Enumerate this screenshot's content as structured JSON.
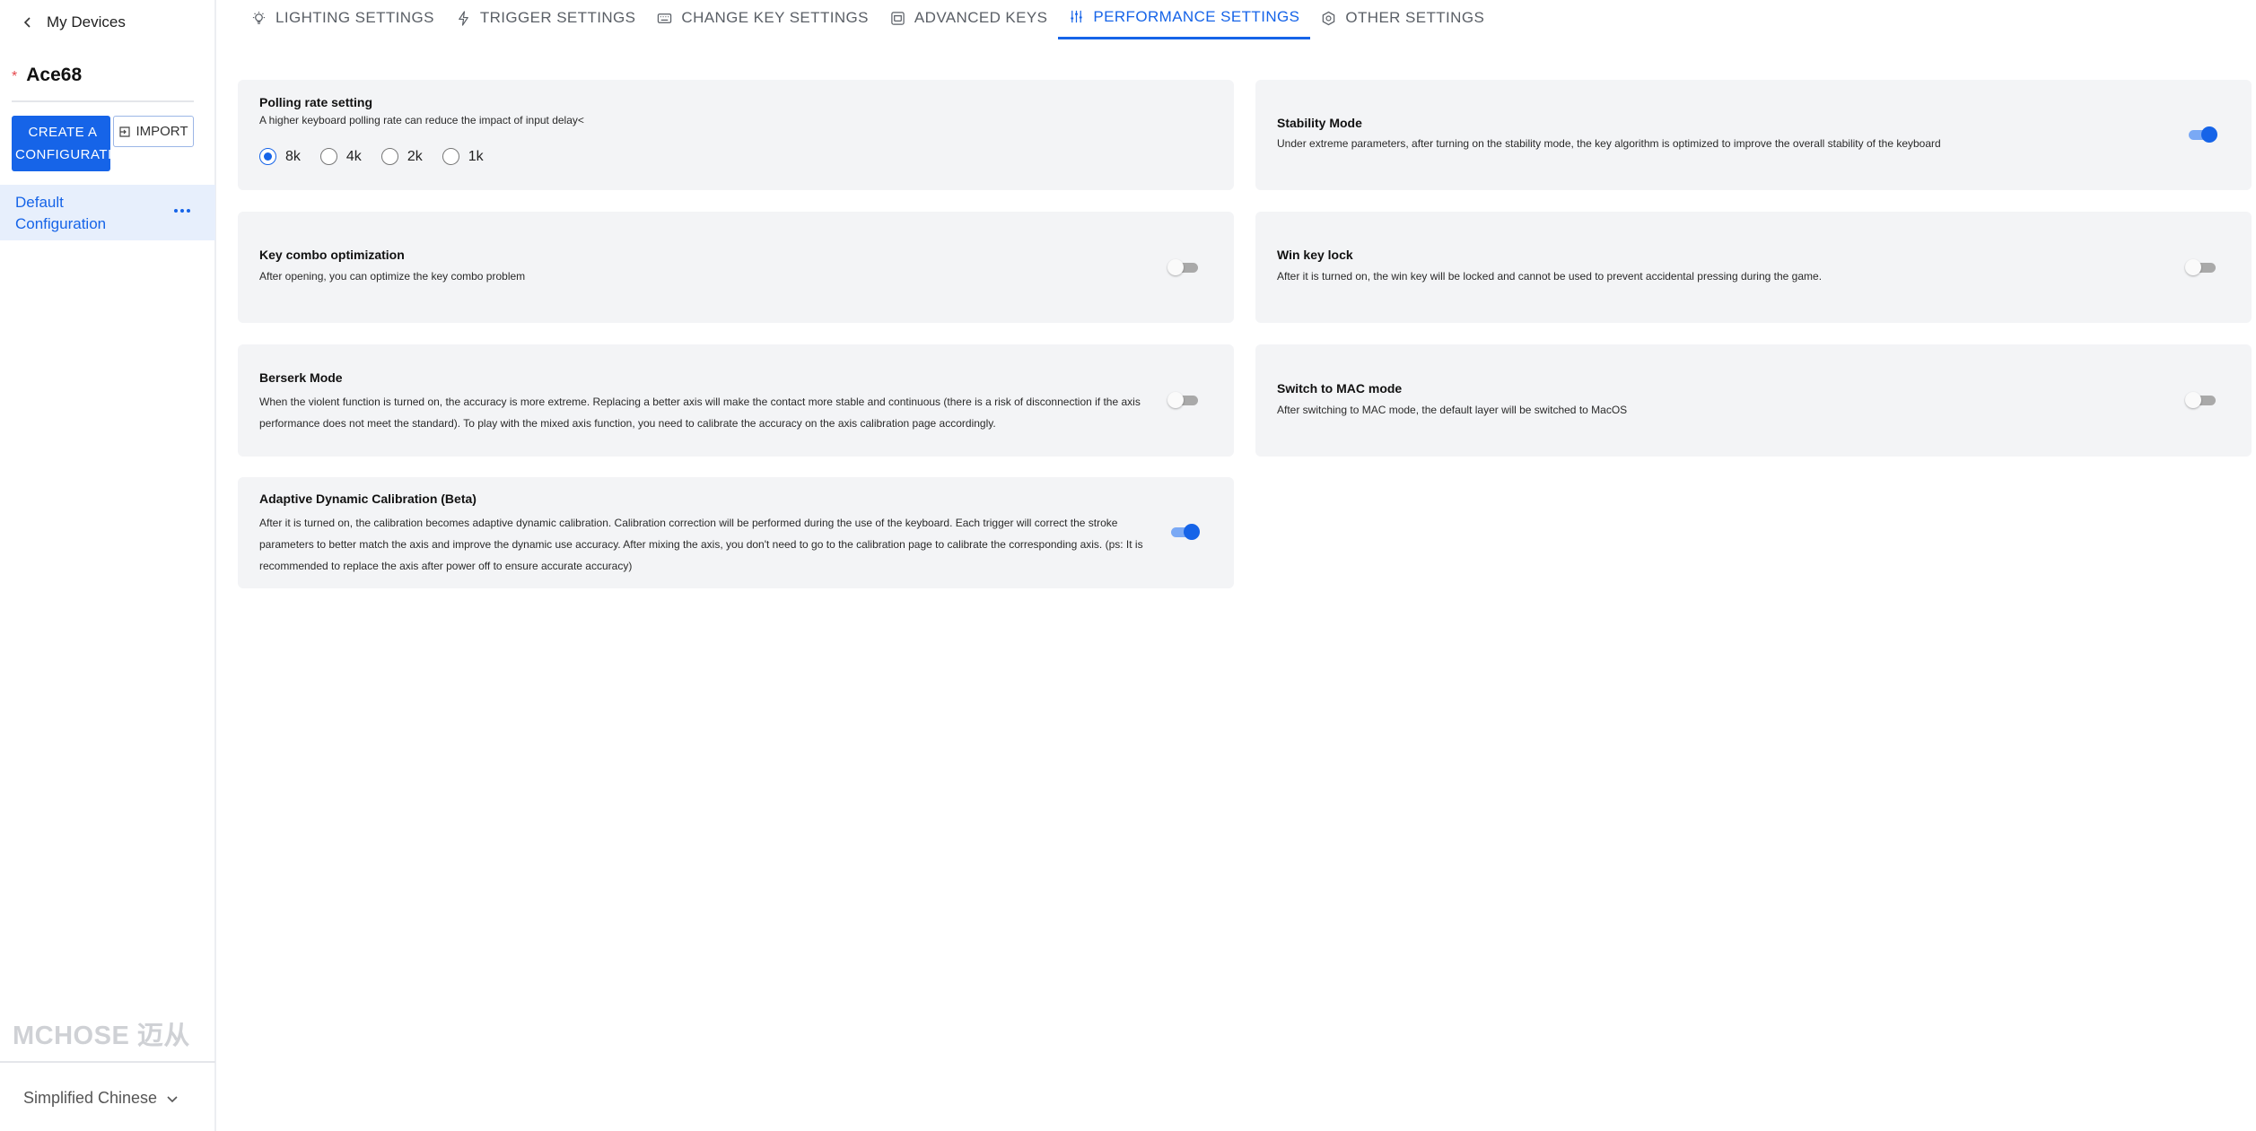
{
  "sidebar": {
    "back_label": "My Devices",
    "device_name": "Ace68",
    "create_label": "CREATE A CONFIGURATION",
    "import_label": "IMPORT",
    "configs": [
      {
        "label": "Default Configuration"
      }
    ],
    "brand": "MCHOSE 迈从",
    "language": "Simplified Chinese"
  },
  "tabs": [
    {
      "label": "LIGHTING SETTINGS",
      "icon": "bulb-icon",
      "active": false
    },
    {
      "label": "TRIGGER SETTINGS",
      "icon": "lightning-icon",
      "active": false
    },
    {
      "label": "CHANGE KEY SETTINGS",
      "icon": "keyboard-icon",
      "active": false
    },
    {
      "label": "ADVANCED KEYS",
      "icon": "advanced-key-icon",
      "active": false
    },
    {
      "label": "PERFORMANCE SETTINGS",
      "icon": "sliders-icon",
      "active": true
    },
    {
      "label": "OTHER SETTINGS",
      "icon": "hexagon-gear-icon",
      "active": false
    }
  ],
  "polling": {
    "title": "Polling rate setting",
    "desc": "A higher keyboard polling rate can reduce the impact of input delay<",
    "options": [
      "8k",
      "4k",
      "2k",
      "1k"
    ],
    "selected": "8k"
  },
  "settings": {
    "stability": {
      "title": "Stability Mode",
      "desc": "Under extreme parameters, after turning on the stability mode, the key algorithm is optimized to improve the overall stability of the keyboard",
      "on": true
    },
    "combo": {
      "title": "Key combo optimization",
      "desc": "After opening, you can optimize the key combo problem",
      "on": false
    },
    "winlock": {
      "title": "Win key lock",
      "desc": "After it is turned on, the win key will be locked and cannot be used to prevent accidental pressing during the game.",
      "on": false
    },
    "berserk": {
      "title": "Berserk Mode",
      "desc": "When the violent function is turned on, the accuracy is more extreme. Replacing a better axis will make the contact more stable and continuous (there is a risk of disconnection if the axis performance does not meet the standard). To play with the mixed axis function, you need to calibrate the accuracy on the axis calibration page accordingly.",
      "on": false
    },
    "mac": {
      "title": "Switch to MAC mode",
      "desc": "After switching to MAC mode, the default layer will be switched to MacOS",
      "on": false
    },
    "adaptive": {
      "title": "Adaptive Dynamic Calibration (Beta)",
      "desc": "After it is turned on, the calibration becomes adaptive dynamic calibration. Calibration correction will be performed during the use of the keyboard. Each trigger will correct the stroke parameters to better match the axis and improve the dynamic use accuracy. After mixing the axis, you don't need to go to the calibration page to calibrate the corresponding axis. (ps: It is recommended to replace the axis after power off to ensure accurate accuracy)",
      "on": true
    }
  },
  "colors": {
    "accent": "#1664e8",
    "card_bg": "#f3f4f6",
    "toggle_off": "#a9a9a9"
  }
}
